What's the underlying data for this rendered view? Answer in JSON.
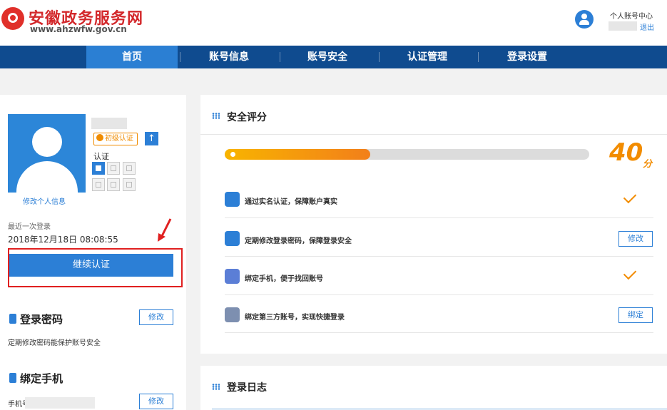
{
  "header": {
    "site_title": "安徽政务服务网",
    "site_url": "www.ahzwfw.gov.cn",
    "user_center": "个人账号中心",
    "logout": "退出"
  },
  "nav": {
    "items": [
      {
        "label": "首页",
        "active": true
      },
      {
        "label": "账号信息",
        "active": false
      },
      {
        "label": "账号安全",
        "active": false
      },
      {
        "label": "认证管理",
        "active": false
      },
      {
        "label": "登录设置",
        "active": false
      }
    ]
  },
  "profile": {
    "level_badge": "初级认证",
    "up_icon": "↑",
    "auth_label": "认证",
    "edit_profile": "修改个人信息",
    "last_login_label": "最近一次登录",
    "last_login_time": "2018年12月18日 08:08:55",
    "continue_button": "继续认证"
  },
  "login_password": {
    "title": "登录密码",
    "button": "修改",
    "description": "定期修改密码能保护账号安全"
  },
  "bind_phone": {
    "title": "绑定手机",
    "button": "修改",
    "label": "手机号"
  },
  "security_score": {
    "title": "安全评分",
    "score": "40",
    "unit": "分",
    "progress_fraction": 0.4,
    "items": [
      {
        "text": "通过实名认证，保障账户真实",
        "status": "done",
        "icon": "id-card-icon",
        "color": "#2c7fd6"
      },
      {
        "text": "定期修改登录密码，保障登录安全",
        "status": "action",
        "action_label": "修改",
        "icon": "key-icon",
        "color": "#2c7fd6"
      },
      {
        "text": "绑定手机，便于找回账号",
        "status": "done",
        "icon": "phone-icon",
        "color": "#5b7ed6"
      },
      {
        "text": "绑定第三方账号，实现快捷登录",
        "status": "action",
        "action_label": "绑定",
        "icon": "link-icon",
        "color": "#7d8fb0"
      }
    ]
  },
  "login_log": {
    "title": "登录日志"
  },
  "colors": {
    "brand_red": "#d3282b",
    "nav_bg": "#0f4b8f",
    "nav_active": "#2b7fd3",
    "primary_blue": "#2c7fd6",
    "score_orange": "#f28c00",
    "highlight_red": "#e02020"
  }
}
